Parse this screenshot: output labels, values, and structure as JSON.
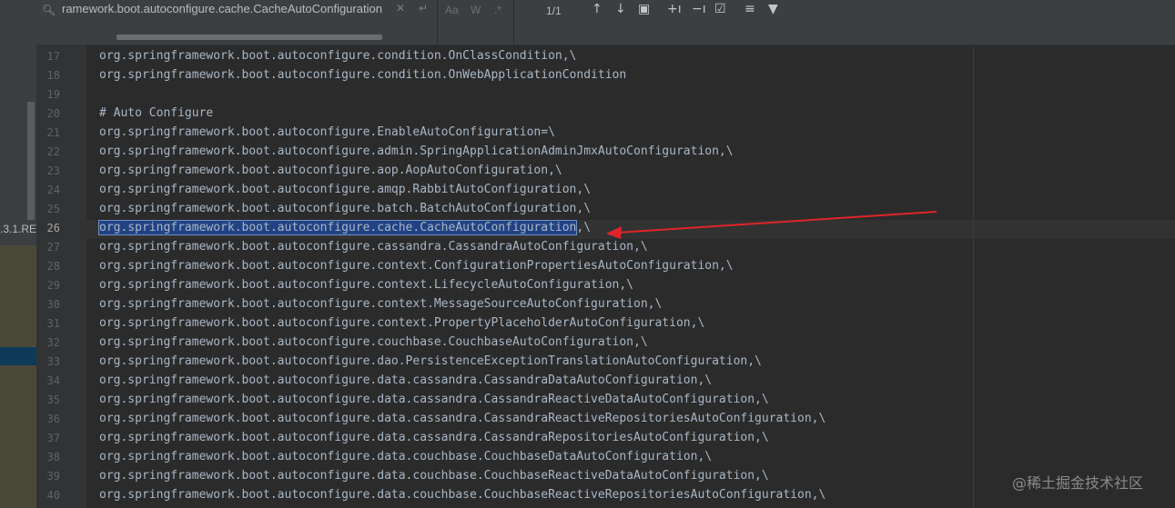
{
  "sidebar": {
    "version_fragment": ".3.1.RE"
  },
  "search": {
    "query": "ramework.boot.autoconfigure.cache.CacheAutoConfiguration",
    "match_case_label": "Aa",
    "words_label": "W",
    "regex_label": ".*",
    "match_count": "1/1",
    "icons": [
      "search-icon",
      "clear-icon",
      "newline-icon",
      "previous-occurrence-icon",
      "next-occurrence-icon",
      "filter-search-results-icon",
      "add-occurrence-icon",
      "remove-occurrence-icon",
      "select-all-occurrences-icon",
      "in-selection-icon",
      "filter-icon"
    ]
  },
  "editor": {
    "current_line": "26",
    "lines": [
      {
        "n": "17",
        "text": "org.springframework.boot.autoconfigure.condition.OnClassCondition,\\"
      },
      {
        "n": "18",
        "text": "org.springframework.boot.autoconfigure.condition.OnWebApplicationCondition"
      },
      {
        "n": "19",
        "text": ""
      },
      {
        "n": "20",
        "text": "# Auto Configure"
      },
      {
        "n": "21",
        "text": "org.springframework.boot.autoconfigure.EnableAutoConfiguration=\\"
      },
      {
        "n": "22",
        "text": "org.springframework.boot.autoconfigure.admin.SpringApplicationAdminJmxAutoConfiguration,\\"
      },
      {
        "n": "23",
        "text": "org.springframework.boot.autoconfigure.aop.AopAutoConfiguration,\\"
      },
      {
        "n": "24",
        "text": "org.springframework.boot.autoconfigure.amqp.RabbitAutoConfiguration,\\"
      },
      {
        "n": "25",
        "text": "org.springframework.boot.autoconfigure.batch.BatchAutoConfiguration,\\"
      },
      {
        "n": "26",
        "text_selected": "org.springframework.boot.autoconfigure.cache.CacheAutoConfiguration",
        "text_rest": ",\\"
      },
      {
        "n": "27",
        "text": "org.springframework.boot.autoconfigure.cassandra.CassandraAutoConfiguration,\\"
      },
      {
        "n": "28",
        "text": "org.springframework.boot.autoconfigure.context.ConfigurationPropertiesAutoConfiguration,\\"
      },
      {
        "n": "29",
        "text": "org.springframework.boot.autoconfigure.context.LifecycleAutoConfiguration,\\"
      },
      {
        "n": "30",
        "text": "org.springframework.boot.autoconfigure.context.MessageSourceAutoConfiguration,\\"
      },
      {
        "n": "31",
        "text": "org.springframework.boot.autoconfigure.context.PropertyPlaceholderAutoConfiguration,\\"
      },
      {
        "n": "32",
        "text": "org.springframework.boot.autoconfigure.couchbase.CouchbaseAutoConfiguration,\\"
      },
      {
        "n": "33",
        "text": "org.springframework.boot.autoconfigure.dao.PersistenceExceptionTranslationAutoConfiguration,\\"
      },
      {
        "n": "34",
        "text": "org.springframework.boot.autoconfigure.data.cassandra.CassandraDataAutoConfiguration,\\"
      },
      {
        "n": "35",
        "text": "org.springframework.boot.autoconfigure.data.cassandra.CassandraReactiveDataAutoConfiguration,\\"
      },
      {
        "n": "36",
        "text": "org.springframework.boot.autoconfigure.data.cassandra.CassandraReactiveRepositoriesAutoConfiguration,\\"
      },
      {
        "n": "37",
        "text": "org.springframework.boot.autoconfigure.data.cassandra.CassandraRepositoriesAutoConfiguration,\\"
      },
      {
        "n": "38",
        "text": "org.springframework.boot.autoconfigure.data.couchbase.CouchbaseDataAutoConfiguration,\\"
      },
      {
        "n": "39",
        "text": "org.springframework.boot.autoconfigure.data.couchbase.CouchbaseReactiveDataAutoConfiguration,\\"
      },
      {
        "n": "40",
        "text": "org.springframework.boot.autoconfigure.data.couchbase.CouchbaseReactiveRepositoriesAutoConfiguration,\\"
      }
    ]
  },
  "annotation": {
    "arrow_color": "#e0242a"
  },
  "watermark": "@稀土掘金技术社区"
}
